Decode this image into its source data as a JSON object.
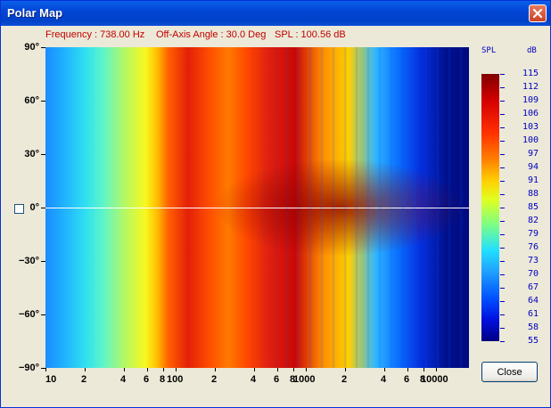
{
  "window": {
    "title": "Polar Map"
  },
  "info": {
    "frequency": "Frequency : 738.00 Hz",
    "angle": "Off-Axis Angle : 30.0 Deg",
    "spl": "SPL : 100.56 dB"
  },
  "yaxis": {
    "ticks": [
      "90°",
      "60°",
      "30°",
      "0°",
      "−30°",
      "−60°",
      "−90°"
    ]
  },
  "xaxis": {
    "ticks": [
      "10",
      "2",
      "4",
      "6",
      "8",
      "100",
      "2",
      "4",
      "6",
      "8",
      "1000",
      "2",
      "4",
      "6",
      "8",
      "10000"
    ]
  },
  "colorbar": {
    "header_left": "SPL",
    "header_right": "dB",
    "ticks": [
      "115",
      "112",
      "109",
      "106",
      "103",
      "100",
      "97",
      "94",
      "91",
      "88",
      "85",
      "82",
      "79",
      "76",
      "73",
      "70",
      "67",
      "64",
      "61",
      "58",
      "55"
    ]
  },
  "buttons": {
    "close_label": "Close"
  },
  "colors": {
    "title_bar": "#0346d6",
    "info_text": "#c00000",
    "colorbar_labels": "#0000c0"
  },
  "icons": {
    "close": "close-icon"
  }
}
